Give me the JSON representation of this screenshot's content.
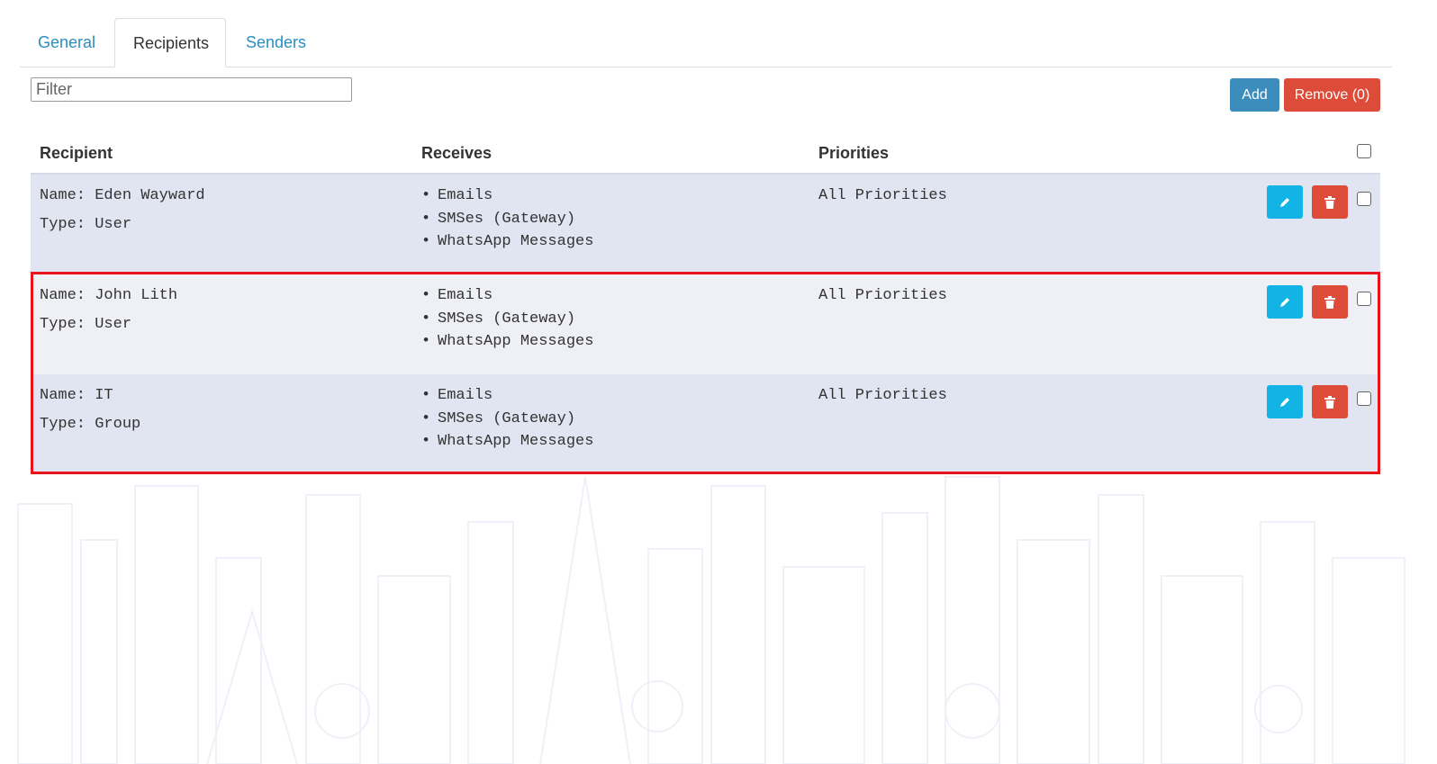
{
  "tabs": [
    {
      "label": "General",
      "active": false
    },
    {
      "label": "Recipients",
      "active": true
    },
    {
      "label": "Senders",
      "active": false
    }
  ],
  "filter": {
    "placeholder": "Filter",
    "value": ""
  },
  "toolbar": {
    "add_label": "Add",
    "remove_label": "Remove (0)"
  },
  "table": {
    "headers": {
      "recipient": "Recipient",
      "receives": "Receives",
      "priorities": "Priorities"
    },
    "rows": [
      {
        "name": "Name: Eden Wayward",
        "type": "Type: User",
        "receives": [
          "Emails",
          "SMSes (Gateway)",
          "WhatsApp Messages"
        ],
        "priorities": "All Priorities"
      },
      {
        "name": "Name: John Lith",
        "type": "Type: User",
        "receives": [
          "Emails",
          "SMSes (Gateway)",
          "WhatsApp Messages"
        ],
        "priorities": "All Priorities"
      },
      {
        "name": "Name: IT",
        "type": "Type: Group",
        "receives": [
          "Emails",
          "SMSes (Gateway)",
          "WhatsApp Messages"
        ],
        "priorities": "All Priorities"
      }
    ]
  },
  "icons": {
    "edit": "pencil-icon",
    "delete": "trash-icon"
  },
  "colors": {
    "tab_link": "#2a8fc0",
    "add_button": "#3c8dbc",
    "remove_button": "#dd4b39",
    "edit_button": "#12b4e6",
    "delete_button": "#dd4b39",
    "row_odd": "#e1e5f2",
    "row_even": "#eff0f6",
    "highlight_border": "#e8141c"
  }
}
